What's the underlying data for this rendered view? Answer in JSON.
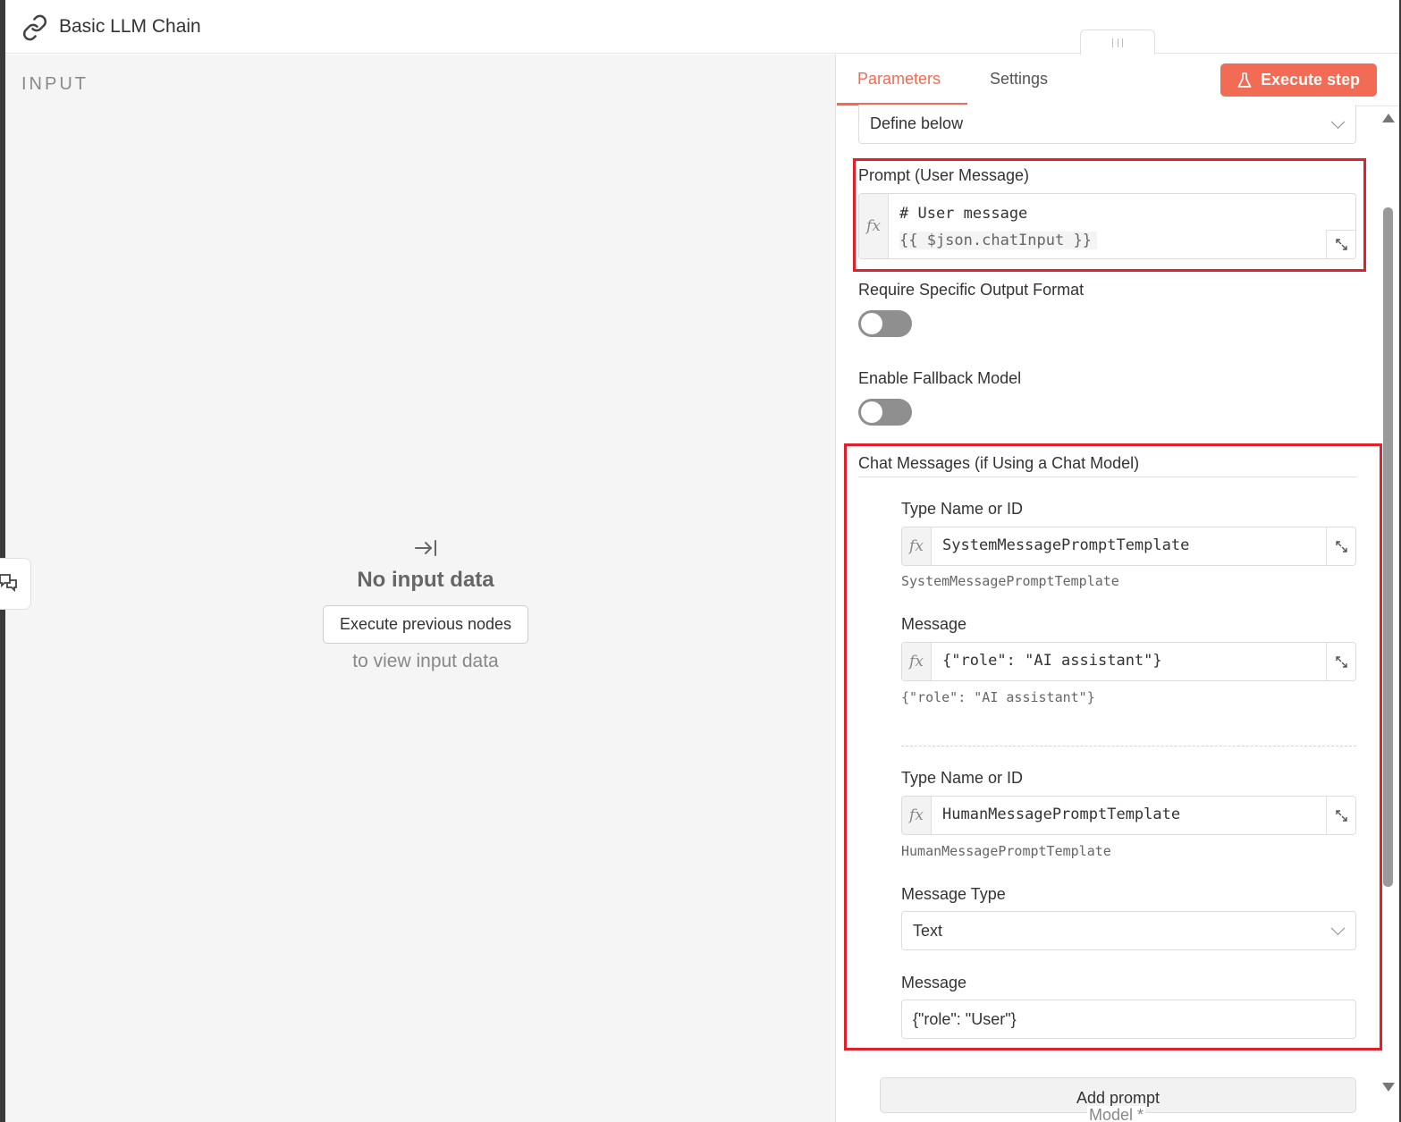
{
  "header": {
    "title": "Basic LLM Chain",
    "icon": "link-icon"
  },
  "input_panel": {
    "label": "INPUT",
    "empty_title": "No input data",
    "execute_previous_label": "Execute previous nodes",
    "hint": "to view input data"
  },
  "tabs": [
    {
      "label": "Parameters"
    },
    {
      "label": "Settings"
    }
  ],
  "execute_step_label": "Execute step",
  "params": {
    "source_select": "Define below",
    "prompt": {
      "label": "Prompt (User Message)",
      "line1": "# User message",
      "line2": "{{ $json.chatInput }}"
    },
    "output_format_label": "Require Specific Output Format",
    "fallback_label": "Enable Fallback Model",
    "chat_messages": {
      "label": "Chat Messages (if Using a Chat Model)",
      "items": [
        {
          "type_label": "Type Name or ID",
          "type_value": "SystemMessagePromptTemplate",
          "type_hint": "SystemMessagePromptTemplate",
          "message_label": "Message",
          "message_value": "{\"role\": \"AI assistant\"}",
          "message_hint": "{\"role\": \"AI assistant\"}"
        },
        {
          "type_label": "Type Name or ID",
          "type_value": "HumanMessagePromptTemplate",
          "type_hint": "HumanMessagePromptTemplate",
          "message_type_label": "Message Type",
          "message_type_value": "Text",
          "message_label": "Message",
          "message_value": "{\"role\": \"User\"}"
        }
      ]
    },
    "add_prompt_label": "Add prompt",
    "model_label": "Model *"
  },
  "colors": {
    "accent": "#f26b55",
    "highlight": "#e0202a"
  }
}
